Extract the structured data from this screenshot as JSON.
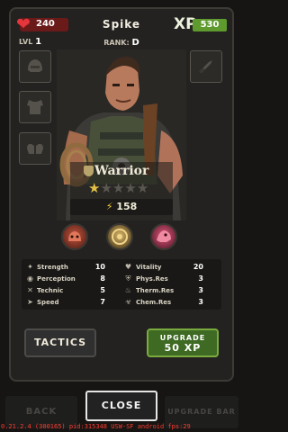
{
  "header": {
    "hp": "240",
    "hero_name": "Spike",
    "xp_label": "XP",
    "xp_value": "530",
    "level_label": "LVL",
    "level_value": "1",
    "rank_label": "RANK:",
    "rank_value": "D"
  },
  "hero": {
    "class_name": "Warrior",
    "stars_filled": 1,
    "stars_total": 5,
    "power": "158"
  },
  "abilities": [
    {
      "icon": "red-beast-ability-icon",
      "color": "#7a2a22"
    },
    {
      "icon": "golden-emblem-ability-icon",
      "color": "#8b6b2a"
    },
    {
      "icon": "pink-creature-ability-icon",
      "color": "#a8345a"
    }
  ],
  "stats": {
    "left": [
      {
        "icon": "strength-icon",
        "label": "Strength",
        "value": "10"
      },
      {
        "icon": "perception-icon",
        "label": "Perception",
        "value": "8"
      },
      {
        "icon": "technic-icon",
        "label": "Technic",
        "value": "5"
      },
      {
        "icon": "speed-icon",
        "label": "Speed",
        "value": "7"
      }
    ],
    "right": [
      {
        "icon": "vitality-icon",
        "label": "Vitality",
        "value": "20"
      },
      {
        "icon": "phys-res-icon",
        "label": "Phys.Res",
        "value": "3"
      },
      {
        "icon": "therm-res-icon",
        "label": "Therm.Res",
        "value": "3"
      },
      {
        "icon": "chem-res-icon",
        "label": "Chem.Res",
        "value": "3"
      }
    ]
  },
  "buttons": {
    "tactics": "TACTICS",
    "upgrade_line1": "UPGRADE",
    "upgrade_line2": "50 XP",
    "back": "BACK",
    "close": "CLOSE",
    "upgrade_bar": "UPGRADE BAR"
  },
  "debug_text": "0.21.2.4 (300165) pid:315348 USW-SF android fps:29",
  "colors": {
    "hp": "#6b1a1a",
    "xp": "#5e9a2d",
    "star_on": "#e2c145",
    "upgrade_button": "#3f6a23"
  }
}
